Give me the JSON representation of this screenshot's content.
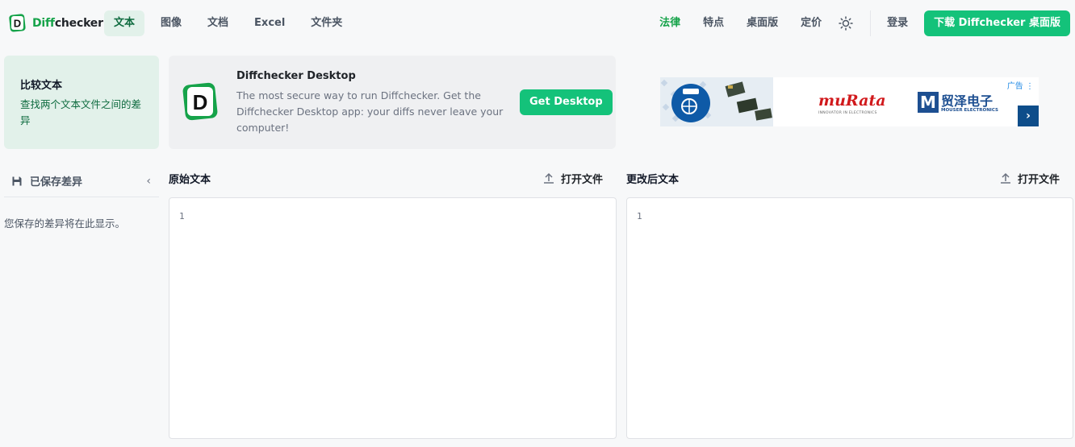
{
  "brand": {
    "part1": "Diff",
    "part2": "checker"
  },
  "nav": {
    "items": [
      "文本",
      "图像",
      "文档",
      "Excel",
      "文件夹"
    ],
    "active": 0
  },
  "right_nav": {
    "legal": "法律",
    "features": "特点",
    "desktop": "桌面版",
    "pricing": "定价",
    "login": "登录",
    "download": "下载 Diffchecker 桌面版"
  },
  "compare_card": {
    "title": "比较文本",
    "desc": "查找两个文本文件之间的差异"
  },
  "desktop_card": {
    "title": "Diffchecker Desktop",
    "desc": "The most secure way to run Diffchecker. Get the Diffchecker Desktop app: your diffs never leave your computer!",
    "button": "Get Desktop"
  },
  "ad": {
    "label": "广告",
    "murata": "muRata",
    "murata_sub": "INNOVATOR IN ELECTRONICS",
    "mouser_cn": "贸泽电子",
    "mouser_en": "MOUSER ELECTRONICS"
  },
  "saved": {
    "title": "已保存差异",
    "empty": "您保存的差异将在此显示。"
  },
  "panes": {
    "left": {
      "title": "原始文本",
      "open": "打开文件",
      "line": "1"
    },
    "right": {
      "title": "更改后文本",
      "open": "打开文件",
      "line": "1"
    }
  }
}
